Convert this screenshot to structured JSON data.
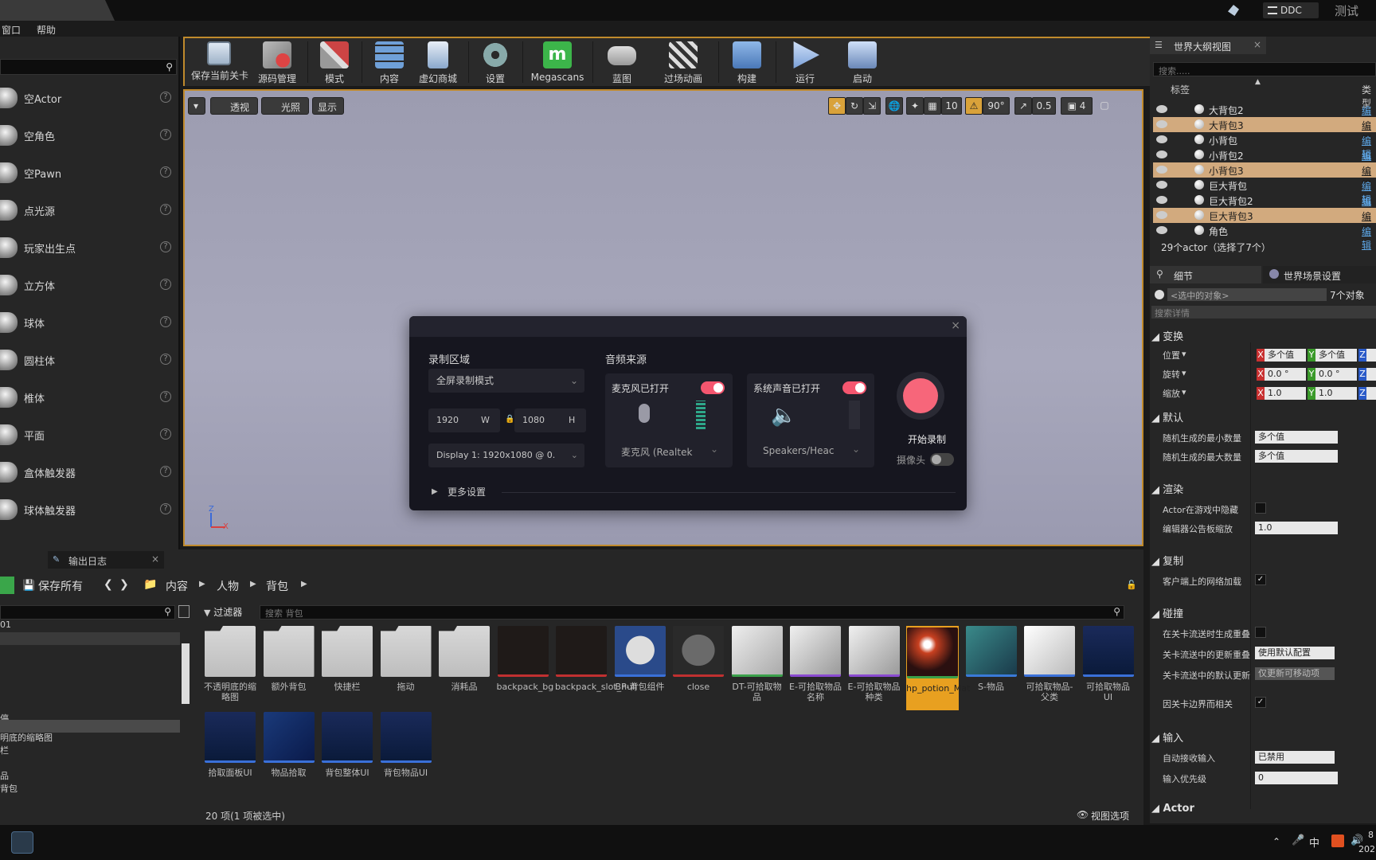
{
  "titlebar": {
    "ddc_label": "DDC",
    "test_label": "测试"
  },
  "menu": {
    "window": "窗口",
    "help": "帮助"
  },
  "place_items": [
    {
      "label": "空Actor"
    },
    {
      "label": "空角色"
    },
    {
      "label": "空Pawn"
    },
    {
      "label": "点光源"
    },
    {
      "label": "玩家出生点"
    },
    {
      "label": "立方体"
    },
    {
      "label": "球体"
    },
    {
      "label": "圆柱体"
    },
    {
      "label": "椎体"
    },
    {
      "label": "平面"
    },
    {
      "label": "盒体触发器"
    },
    {
      "label": "球体触发器"
    }
  ],
  "toolbar": {
    "save_level": "保存当前关卡",
    "source_control": "源码管理",
    "modes": "模式",
    "content": "内容",
    "marketplace": "虚幻商城",
    "settings": "设置",
    "megascans": "Megascans",
    "blueprints": "蓝图",
    "cinematics": "过场动画",
    "build": "构建",
    "play": "运行",
    "launch": "启动"
  },
  "viewport": {
    "perspective": "透视",
    "lit": "光照",
    "show": "显示",
    "grid_snap": "10",
    "rot_snap": "90°",
    "scale_snap": "0.5",
    "cam_speed": "4"
  },
  "recorder": {
    "area_title": "录制区域",
    "mode": "全屏录制模式",
    "width": "1920",
    "w": "W",
    "height": "1080",
    "h": "H",
    "display": "Display 1: 1920x1080 @ 0.",
    "audio_title": "音频来源",
    "mic_on": "麦克风已打开",
    "mic_device": "麦克风 (Realtek",
    "sys_on": "系统声音已打开",
    "sys_device": "Speakers/Heac",
    "start": "开始录制",
    "camera": "摄像头",
    "more": "更多设置"
  },
  "outliner": {
    "title": "世界大纲视图",
    "search": "搜索.....",
    "col_label": "标签",
    "col_type": "类型",
    "rows": [
      {
        "name": "大背包2",
        "type": "编辑",
        "sel": false
      },
      {
        "name": "大背包3",
        "type": "编辑",
        "sel": true
      },
      {
        "name": "小背包",
        "type": "编辑",
        "sel": false
      },
      {
        "name": "小背包2",
        "type": "编辑",
        "sel": false
      },
      {
        "name": "小背包3",
        "type": "编辑",
        "sel": true
      },
      {
        "name": "巨大背包",
        "type": "编辑",
        "sel": false
      },
      {
        "name": "巨大背包2",
        "type": "编辑",
        "sel": false
      },
      {
        "name": "巨大背包3",
        "type": "编辑",
        "sel": true
      },
      {
        "name": "角色",
        "type": "编辑",
        "sel": false
      }
    ],
    "summary": "29个actor（选择了7个）"
  },
  "details": {
    "tab_details": "细节",
    "tab_world": "世界场景设置",
    "selected": "<选中的对象>",
    "count": "7个对象",
    "search": "搜索详情",
    "transform": "变换",
    "location": "位置",
    "rotation": "旋转",
    "scale": "缩放",
    "multi": "多个值",
    "rot_val": "0.0 °",
    "scale_val": "1.0",
    "default": "默认",
    "rand_min": "随机生成的最小数量",
    "rand_max": "随机生成的最大数量",
    "render": "渲染",
    "hidden": "Actor在游戏中隐藏",
    "billboard": "编辑器公告板缩放",
    "billboard_val": "1.0",
    "replication": "复制",
    "net_load": "客户端上的网络加载",
    "collision": "碰撞",
    "gen_overlap": "在关卡流送时生成重叠",
    "update_overlap": "关卡流送中的更新重叠",
    "update_val": "使用默认配置",
    "default_update": "关卡流送中的默认更新",
    "default_update_val": "仅更新可移动项",
    "bounds": "因关卡边界而相关",
    "input": "输入",
    "auto_input": "自动接收输入",
    "auto_input_val": "已禁用",
    "input_priority": "输入优先级",
    "input_priority_val": "0",
    "actor": "Actor"
  },
  "content_browser": {
    "output_log": "输出日志",
    "save_all": "保存所有",
    "path": [
      "内容",
      "人物",
      "背包"
    ],
    "filters": "过滤器",
    "search": "搜索 背包",
    "assets": [
      {
        "name": "不透明底的缩略图",
        "kind": "folder"
      },
      {
        "name": "额外背包",
        "kind": "folder"
      },
      {
        "name": "快捷栏",
        "kind": "folder"
      },
      {
        "name": "拖动",
        "kind": "folder"
      },
      {
        "name": "消耗品",
        "kind": "folder"
      },
      {
        "name": "backpack_bg",
        "kind": "texture"
      },
      {
        "name": "backpack_slot_null",
        "kind": "texture"
      },
      {
        "name": "BP-背包组件",
        "kind": "bp"
      },
      {
        "name": "close",
        "kind": "texture"
      },
      {
        "name": "DT-可拾取物品",
        "kind": "dt"
      },
      {
        "name": "E-可拾取物品名称",
        "kind": "enum"
      },
      {
        "name": "E-可拾取物品种类",
        "kind": "enum"
      },
      {
        "name": "hp_potion_Mat",
        "kind": "mat"
      },
      {
        "name": "S-物品",
        "kind": "struct"
      },
      {
        "name": "可拾取物品-父类",
        "kind": "actor"
      },
      {
        "name": "可拾取物品UI",
        "kind": "widget"
      },
      {
        "name": "拾取面板UI",
        "kind": "widget"
      },
      {
        "name": "物品拾取",
        "kind": "bpi"
      },
      {
        "name": "背包整体UI",
        "kind": "widget"
      },
      {
        "name": "背包物品UI",
        "kind": "widget"
      }
    ],
    "status": "20 项(1 项被选中)",
    "view_options": "视图选项",
    "tree": [
      "01",
      "停",
      "明底的缩略图",
      "栏",
      "品",
      "背包"
    ]
  },
  "taskbar": {
    "ime": "中",
    "time": "8",
    "date": "202"
  }
}
